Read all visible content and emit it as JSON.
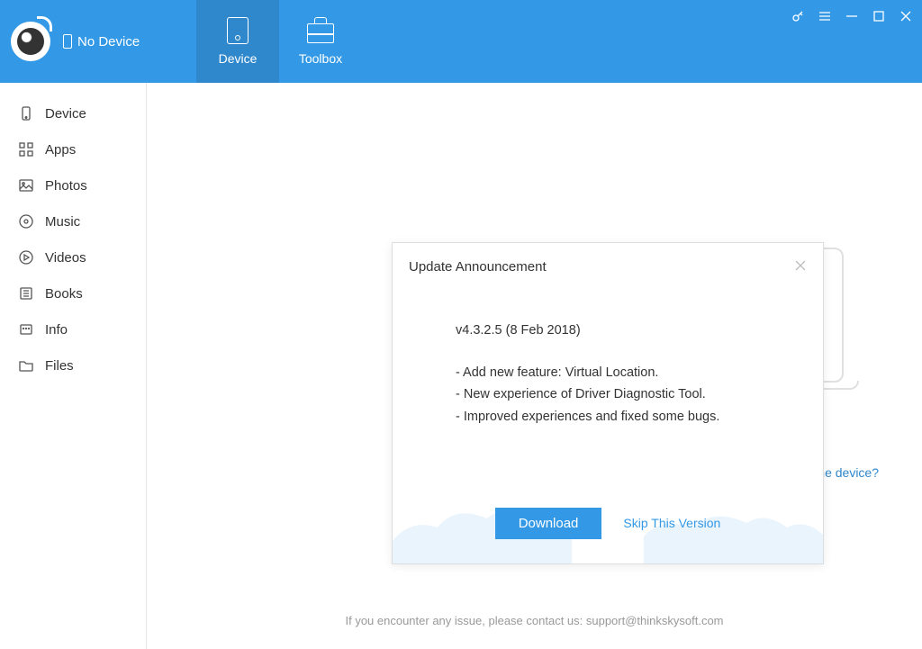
{
  "header": {
    "device_status": "No Device",
    "tabs": {
      "device": "Device",
      "toolbox": "Toolbox"
    }
  },
  "sidebar": {
    "items": [
      {
        "label": "Device",
        "icon": "device-icon"
      },
      {
        "label": "Apps",
        "icon": "apps-icon"
      },
      {
        "label": "Photos",
        "icon": "photos-icon"
      },
      {
        "label": "Music",
        "icon": "music-icon"
      },
      {
        "label": "Videos",
        "icon": "videos-icon"
      },
      {
        "label": "Books",
        "icon": "books-icon"
      },
      {
        "label": "Info",
        "icon": "info-icon"
      },
      {
        "label": "Files",
        "icon": "files-icon"
      }
    ]
  },
  "main": {
    "help_link": "Cannot recognize the device?",
    "footer": "If you encounter any issue, please contact us: support@thinkskysoft.com"
  },
  "modal": {
    "title": "Update Announcement",
    "version_line": "v4.3.2.5 (8 Feb 2018)",
    "notes": [
      "- Add new feature: Virtual Location.",
      "- New experience of Driver Diagnostic Tool.",
      "- Improved experiences and fixed some bugs."
    ],
    "download_label": "Download",
    "skip_label": "Skip This Version"
  }
}
